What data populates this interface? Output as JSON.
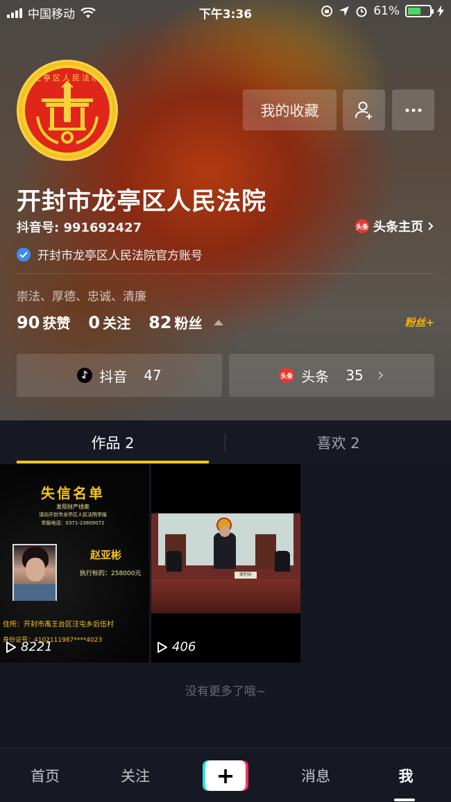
{
  "status_bar": {
    "carrier": "中国移动",
    "time": "下午3:36",
    "battery_percent": "61%",
    "battery_level": 0.61
  },
  "avatar": {
    "ring_text": "龙亭区人民法院",
    "colors": {
      "outer": "#f6c21a",
      "inner": "#e0261a"
    }
  },
  "actions": {
    "favorites_label": "我的收藏",
    "add_friend_icon": "add-user-icon",
    "more_icon": "more-icon"
  },
  "profile": {
    "name": "开封市龙亭区人民法院",
    "douyin_id": "抖音号: 991692427",
    "toutiao_home": "头条主页",
    "toutiao_badge": "头条",
    "verification": "开封市龙亭区人民法院官方账号",
    "bio": "崇法、厚德、忠诚、清廉"
  },
  "stats": {
    "likes_num": "90",
    "likes_label": "获赞",
    "following_num": "0",
    "following_label": "关注",
    "fans_num": "82",
    "fans_label": "粉丝",
    "fans_plus": "粉丝+"
  },
  "platforms": {
    "douyin_label": "抖音",
    "douyin_count": "47",
    "toutiao_label": "头条",
    "toutiao_badge": "头条",
    "toutiao_count": "35"
  },
  "tabs": {
    "works": "作品 2",
    "likes": "喜欢 2"
  },
  "videos": [
    {
      "title": "失信名单",
      "line1": "发现财产线索",
      "line2": "请向开封市龙亭区人民法院举报",
      "line3": "举报电话：0371-23809072",
      "person": "赵亚彬",
      "amount": "执行标的：258000元",
      "address": "住所：开封市禹王台区汪屯乡后伍村",
      "id_number": "身份证号：4102111987****4023",
      "plays": "8221"
    },
    {
      "court_sign": "审判长",
      "plays": "406"
    }
  ],
  "no_more": "没有更多了哦~",
  "nav": {
    "home": "首页",
    "follow": "关注",
    "plus": "+",
    "messages": "消息",
    "me": "我"
  },
  "colors": {
    "accent_yellow": "#f7c61b",
    "verify_blue": "#3c8cf0",
    "toutiao_red": "#e8382e",
    "douyin_cyan": "#2de3e3",
    "douyin_pink": "#ff2d55",
    "background": "#161823"
  }
}
